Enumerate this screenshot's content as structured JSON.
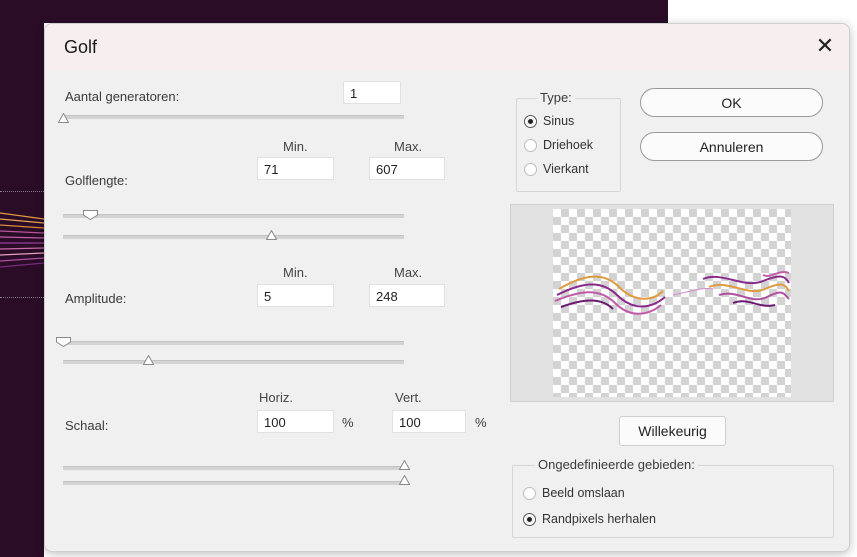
{
  "dialog": {
    "title": "Golf",
    "close_symbol": "✕"
  },
  "generators": {
    "label": "Aantal generatoren:",
    "value": "1",
    "slider_fraction": 0.0
  },
  "wavelength": {
    "label": "Golflengte:",
    "min_header": "Min.",
    "max_header": "Max.",
    "min_value": "71",
    "max_value": "607",
    "min_slider_fraction": 0.08,
    "max_slider_fraction": 0.61
  },
  "amplitude": {
    "label": "Amplitude:",
    "min_header": "Min.",
    "max_header": "Max.",
    "min_value": "5",
    "max_value": "248",
    "min_slider_fraction": 0.0,
    "max_slider_fraction": 0.25
  },
  "scale": {
    "label": "Schaal:",
    "horiz_header": "Horiz.",
    "vert_header": "Vert.",
    "horiz_value": "100",
    "vert_value": "100",
    "unit": "%",
    "horiz_slider_fraction": 1.0,
    "vert_slider_fraction": 1.0
  },
  "type_group": {
    "title": "Type:",
    "options": [
      "Sinus",
      "Driehoek",
      "Vierkant"
    ],
    "selected": "Sinus"
  },
  "buttons": {
    "ok": "OK",
    "cancel": "Annuleren",
    "randomize": "Willekeurig"
  },
  "undefined_areas": {
    "title": "Ongedefinieerde gebieden:",
    "options": [
      "Beeld omslaan",
      "Randpixels herhalen"
    ],
    "selected": "Randpixels herhalen"
  },
  "colors": {
    "dark_background": "#2a0c27",
    "wave_purple": "#8a2a8a",
    "wave_orange": "#e09a40"
  }
}
